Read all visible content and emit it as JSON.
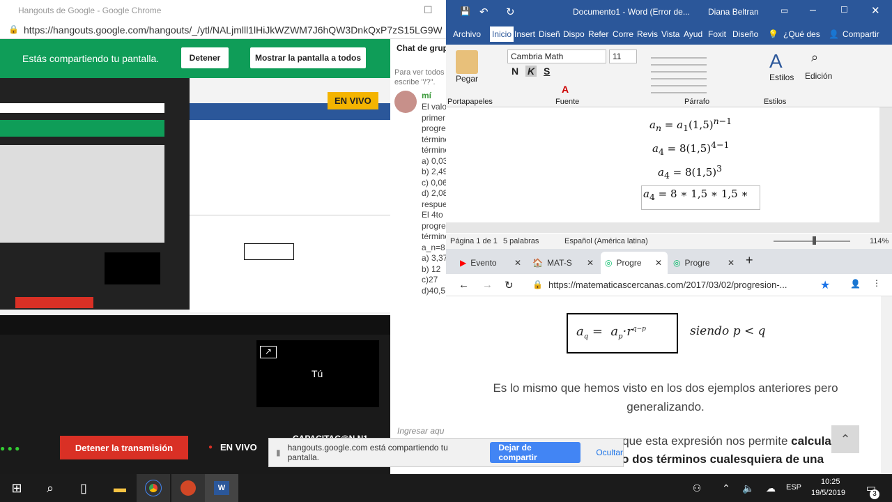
{
  "left_chrome": {
    "title": "Hangouts de Google - Google Chrome",
    "url": "https://hangouts.google.com/hangouts/_/ytl/NALjmlll1lHiJkWZWM7J6hQW3DnkQxP7zS15LG9W..."
  },
  "sharebar": {
    "message": "Estás compartiendo tu pantalla.",
    "stop": "Detener",
    "show_all": "Mostrar la pantalla a todos"
  },
  "live_badge": "EN VIVO",
  "chat": {
    "title": "Chat de grupo",
    "intro": [
      "Para ver todos",
      "escribe \"/?\"."
    ],
    "author": "mí",
    "lines": [
      "El valo",
      "primer",
      "progre",
      "término",
      "término",
      "a) 0,03",
      "b) 2,49",
      "c) 0,06",
      "d) 2,08",
      "respue",
      "El 4to",
      "progre",
      "término",
      "a_n=8",
      "a) 3,37",
      "b) 12",
      "c)27",
      "d)40,5"
    ],
    "input_placeholder": "Ingresar aqu"
  },
  "tu_label": "Tú",
  "stop_broadcast": "Detener la transmisión",
  "envivo_bottom": "EN VIVO",
  "capacitacion": "CAPACITAC@N N1",
  "word": {
    "title": "Documento1 - Word (Error de...",
    "user": "Diana Beltran",
    "tabs": [
      "Archivo",
      "Inicio",
      "Insert",
      "Diseñ",
      "Dispo",
      "Refer",
      "Corre",
      "Revis",
      "Vista",
      "Ayud",
      "Foxit",
      "Diseño"
    ],
    "search": "¿Qué des",
    "share": "Compartir",
    "font": "Cambria Math",
    "size": "11",
    "paste": "Pegar",
    "groups": {
      "clipboard": "Portapapeles",
      "font": "Fuente",
      "paragraph": "Párrafo",
      "styles": "Estilos"
    },
    "styles_btn": "Estilos",
    "edit_btn": "Edición",
    "equations": [
      "a_n = a_1(1,5)^(n-1)",
      "a_4 = 8(1,5)^(4-1)",
      "a_4 = 8(1,5)^3",
      "a_4 = 8 * 1,5 * 1,5 *"
    ],
    "status": {
      "page": "Página 1 de 1",
      "words": "5 palabras",
      "lang": "Español (América latina)",
      "zoom": "114%"
    }
  },
  "browser": {
    "tabs": [
      "Evento",
      "MAT-S",
      "Progre",
      "Progre"
    ],
    "url": "https://matematicascercanas.com/2017/03/02/progresion-...",
    "formula_note": "siendo  p < q",
    "para1": "Es lo mismo que hemos visto en los dos ejemplos anteriores pero generalizando.",
    "para2_a": "s que esta expresión nos permite ",
    "para2_b": "calcular",
    "para3": "o dos términos cualesquiera de una"
  },
  "share_notice": {
    "text": "hangouts.google.com está compartiendo tu pantalla.",
    "stop": "Dejar de compartir",
    "hide": "Ocultar"
  },
  "taskbar": {
    "lang": "ESP",
    "time": "10:25",
    "date": "19/5/2019",
    "notif": "3"
  }
}
